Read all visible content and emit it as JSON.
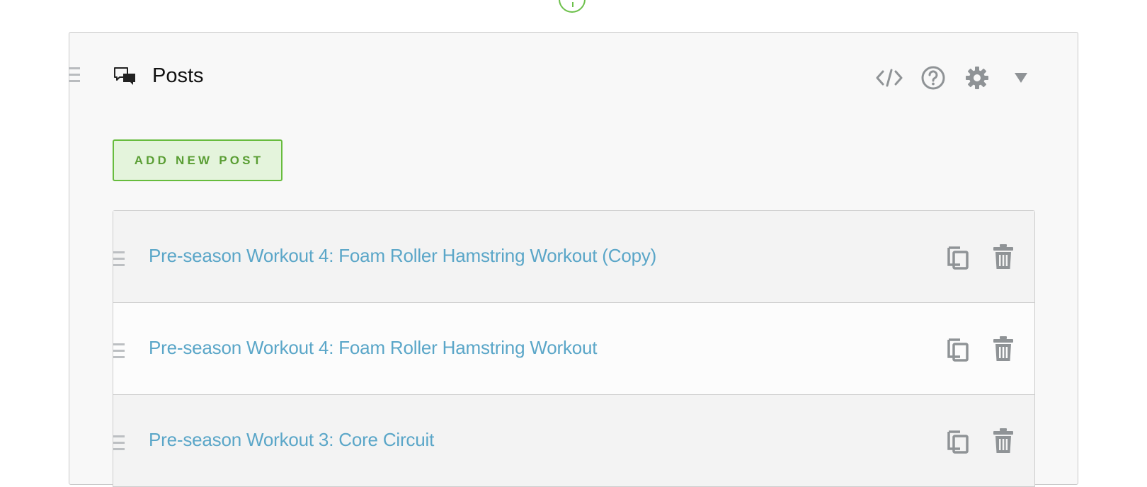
{
  "panel": {
    "title": "Posts",
    "icon": "chat-bubbles-icon",
    "tools": [
      {
        "name": "embed-code-icon"
      },
      {
        "name": "help-icon"
      },
      {
        "name": "settings-gear-icon"
      },
      {
        "name": "collapse-arrow-icon"
      }
    ]
  },
  "add_button": {
    "label": "ADD NEW POST"
  },
  "posts": [
    {
      "title": "Pre-season Workout 4: Foam Roller Hamstring Workout (Copy)"
    },
    {
      "title": "Pre-season Workout 4: Foam Roller Hamstring Workout"
    },
    {
      "title": "Pre-season Workout 3: Core Circuit"
    }
  ],
  "colors": {
    "accent_green": "#67bc3d",
    "link_blue": "#5aa6c8",
    "icon_gray": "#8f9396"
  }
}
